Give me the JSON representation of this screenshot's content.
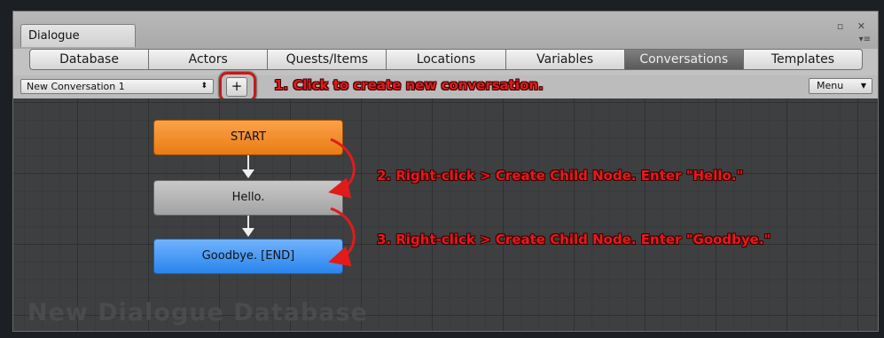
{
  "window": {
    "tab_title": "Dialogue",
    "controls": "▫ ✕",
    "menu_icon": "▾≡"
  },
  "tabs": [
    {
      "label": "Database",
      "active": false
    },
    {
      "label": "Actors",
      "active": false
    },
    {
      "label": "Quests/Items",
      "active": false
    },
    {
      "label": "Locations",
      "active": false
    },
    {
      "label": "Variables",
      "active": false
    },
    {
      "label": "Conversations",
      "active": true
    },
    {
      "label": "Templates",
      "active": false
    }
  ],
  "toolbar": {
    "conversation_select": "New Conversation 1",
    "select_arrows": "⬍",
    "add_label": "+",
    "menu_label": "Menu",
    "menu_caret": "▼"
  },
  "nodes": {
    "start": "START",
    "hello": "Hello.",
    "end": "Goodbye. [END]"
  },
  "annotations": {
    "step1": "1. Click to create new conversation.",
    "step2": "2. Right-click > Create Child Node. Enter \"Hello.\"",
    "step3": "3. Right-click > Create Child Node. Enter \"Goodbye.\""
  },
  "canvas": {
    "watermark": "New Dialogue Database"
  },
  "colors": {
    "start_node": "#f08a1e",
    "normal_node": "#b5b5b5",
    "end_node": "#4a9cf7",
    "annotation": "#e31a1a",
    "active_tab": "#6b6b6b"
  },
  "icons": {
    "maximize": "restore-icon",
    "close": "close-icon",
    "menu": "menu-lines-icon",
    "select_arrows": "updown-icon",
    "add": "plus-icon"
  }
}
